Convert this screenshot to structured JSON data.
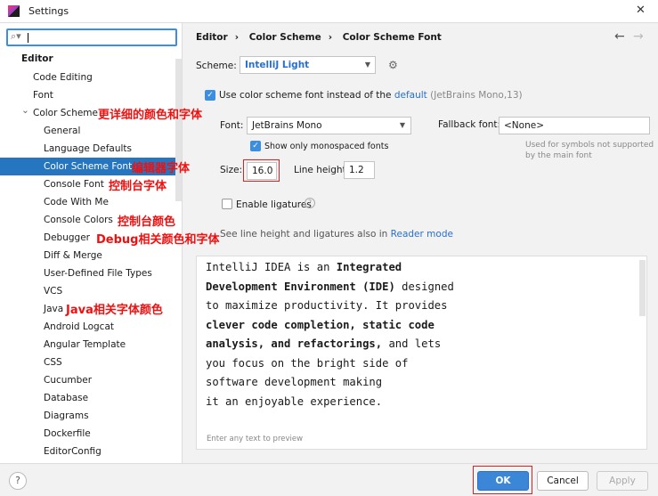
{
  "window": {
    "title": "Settings",
    "close": "✕"
  },
  "search": {
    "value": "",
    "icon": "search-icon"
  },
  "sidebar": {
    "section": "Editor",
    "items": [
      {
        "label": "Code Editing",
        "level": 1
      },
      {
        "label": "Font",
        "level": 1
      },
      {
        "label": "Color Scheme",
        "level": 1,
        "expanded": true
      },
      {
        "label": "General",
        "level": 2
      },
      {
        "label": "Language Defaults",
        "level": 2
      },
      {
        "label": "Color Scheme Font",
        "level": 2,
        "selected": true
      },
      {
        "label": "Console Font",
        "level": 2
      },
      {
        "label": "Code With Me",
        "level": 2
      },
      {
        "label": "Console Colors",
        "level": 2
      },
      {
        "label": "Debugger",
        "level": 2
      },
      {
        "label": "Diff & Merge",
        "level": 2
      },
      {
        "label": "User-Defined File Types",
        "level": 2
      },
      {
        "label": "VCS",
        "level": 2
      },
      {
        "label": "Java",
        "level": 2
      },
      {
        "label": "Android Logcat",
        "level": 2
      },
      {
        "label": "Angular Template",
        "level": 2
      },
      {
        "label": "CSS",
        "level": 2
      },
      {
        "label": "Cucumber",
        "level": 2
      },
      {
        "label": "Database",
        "level": 2
      },
      {
        "label": "Diagrams",
        "level": 2
      },
      {
        "label": "Dockerfile",
        "level": 2
      },
      {
        "label": "EditorConfig",
        "level": 2
      }
    ]
  },
  "annotations": [
    "更详细的颜色和字体",
    "编辑器字体",
    "控制台字体",
    "控制台颜色",
    "Debug相关颜色和字体",
    "Java相关字体颜色"
  ],
  "breadcrumb": [
    "Editor",
    "Color Scheme",
    "Color Scheme Font"
  ],
  "scheme": {
    "label": "Scheme:",
    "value": "IntelliJ Light"
  },
  "use_scheme_font": {
    "checked": true,
    "label": "Use color scheme font instead of the",
    "link": "default",
    "hint": "(JetBrains Mono,13)"
  },
  "font": {
    "label": "Font:",
    "value": "JetBrains Mono"
  },
  "fallback": {
    "label": "Fallback font:",
    "value": "<None>",
    "hint1": "Used for symbols not supported",
    "hint2": "by the main font"
  },
  "monospaced": {
    "checked": true,
    "label": "Show only monospaced fonts"
  },
  "size": {
    "label": "Size:",
    "value": "16.0"
  },
  "line_height": {
    "label": "Line height:",
    "value": "1.2"
  },
  "ligatures": {
    "checked": false,
    "label": "Enable ligatures"
  },
  "reader": {
    "text": "See line height and ligatures also in",
    "link": "Reader mode"
  },
  "preview": {
    "lines": [
      [
        {
          "t": "IntelliJ IDEA is an "
        },
        {
          "t": "Integrated",
          "b": true
        }
      ],
      [
        {
          "t": "Development Environment (IDE)",
          "b": true
        },
        {
          "t": " designed"
        }
      ],
      [
        {
          "t": "to maximize productivity. It provides"
        }
      ],
      [
        {
          "t": "clever code completion, static code",
          "b": true
        }
      ],
      [
        {
          "t": "analysis, and refactorings,",
          "b": true
        },
        {
          "t": " and lets"
        }
      ],
      [
        {
          "t": "you focus on the bright side of"
        }
      ],
      [
        {
          "t": "software development making"
        }
      ],
      [
        {
          "t": "it an enjoyable experience."
        }
      ]
    ],
    "placeholder": "Enter any text to preview"
  },
  "buttons": {
    "ok": "OK",
    "cancel": "Cancel",
    "apply": "Apply",
    "help": "?"
  },
  "colors": {
    "accent": "#2675bf",
    "annotation": "#f01010"
  }
}
